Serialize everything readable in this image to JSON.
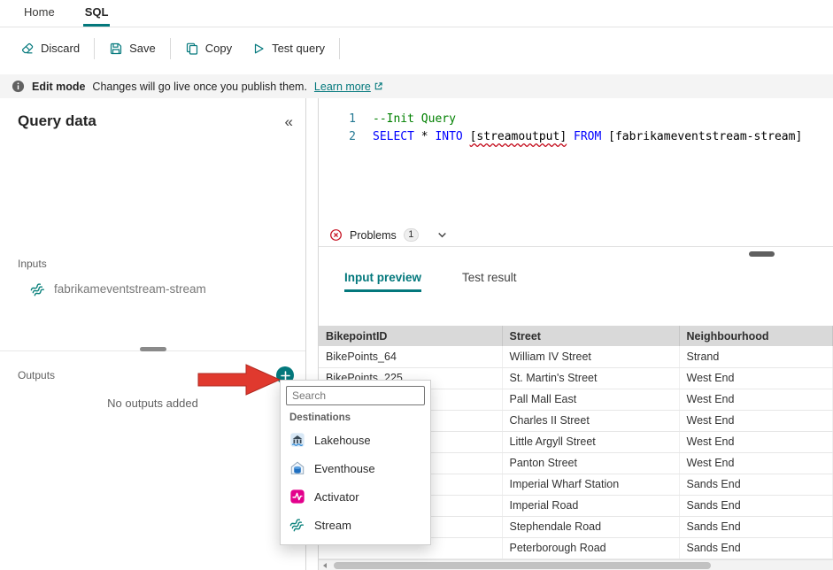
{
  "colors": {
    "accent": "#03787c",
    "error": "#c50f1f",
    "arrow": "#e0392e",
    "stream": "#0b827c"
  },
  "tab_bar": {
    "home": "Home",
    "sql": "SQL"
  },
  "toolbar": {
    "discard": "Discard",
    "save": "Save",
    "copy": "Copy",
    "test": "Test query"
  },
  "banner": {
    "bold": "Edit mode",
    "text": "Changes will go live once you publish them.",
    "link": "Learn more"
  },
  "panel": {
    "title": "Query data",
    "collapse": "«",
    "inputs": "Inputs",
    "input_name": "fabrikameventstream-stream",
    "outputs": "Outputs",
    "empty": "No outputs added"
  },
  "editor": {
    "line1_no": "1",
    "line2_no": "2",
    "comment": "--Init Query",
    "tokens": [
      {
        "text": "SELECT",
        "type": "kw"
      },
      {
        "text": " * ",
        "type": "pl"
      },
      {
        "text": "INTO",
        "type": "kw"
      },
      {
        "text": " ",
        "type": "pl"
      },
      {
        "text": "[streamoutput]",
        "type": "err"
      },
      {
        "text": " ",
        "type": "pl"
      },
      {
        "text": "FROM",
        "type": "kw"
      },
      {
        "text": " ",
        "type": "pl"
      },
      {
        "text": "[fabrikameventstream-stream]",
        "type": "pl"
      }
    ],
    "problems_label": "Problems",
    "problems_count": "1"
  },
  "preview": {
    "tab_input": "Input preview",
    "tab_test": "Test result",
    "headers": [
      "BikepointID",
      "Street",
      "Neighbourhood"
    ],
    "rows": [
      [
        "BikePoints_64",
        "William IV Street",
        "Strand"
      ],
      [
        "BikePoints_225",
        "St. Martin's Street",
        "West End"
      ],
      [
        "",
        "Pall Mall East",
        "West End"
      ],
      [
        "",
        "Charles II Street",
        "West End"
      ],
      [
        "",
        "Little Argyll Street",
        "West End"
      ],
      [
        "",
        "Panton Street",
        "West End"
      ],
      [
        "",
        "Imperial Wharf Station",
        "Sands End"
      ],
      [
        "",
        "Imperial Road",
        "Sands End"
      ],
      [
        "",
        "Stephendale Road",
        "Sands End"
      ],
      [
        "",
        "Peterborough Road",
        "Sands End"
      ]
    ]
  },
  "menu": {
    "search_placeholder": "Search",
    "section": "Destinations",
    "items": [
      {
        "label": "Lakehouse",
        "icon": "lakehouse-icon"
      },
      {
        "label": "Eventhouse",
        "icon": "eventhouse-icon"
      },
      {
        "label": "Activator",
        "icon": "activator-icon"
      },
      {
        "label": "Stream",
        "icon": "stream-icon"
      }
    ]
  }
}
